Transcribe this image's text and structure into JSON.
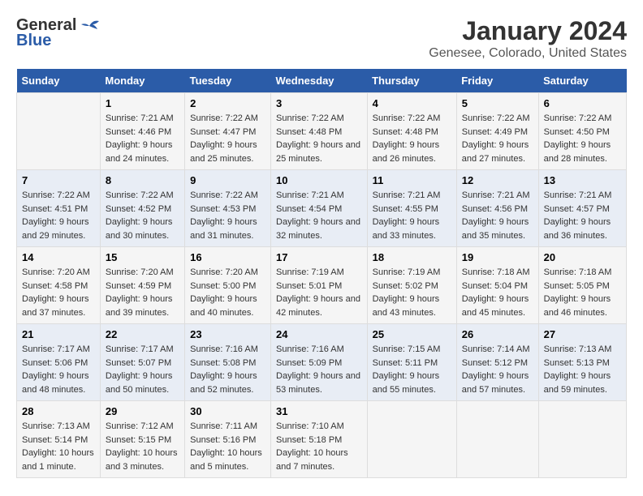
{
  "header": {
    "logo_general": "General",
    "logo_blue": "Blue",
    "title": "January 2024",
    "subtitle": "Genesee, Colorado, United States"
  },
  "days_of_week": [
    "Sunday",
    "Monday",
    "Tuesday",
    "Wednesday",
    "Thursday",
    "Friday",
    "Saturday"
  ],
  "weeks": [
    [
      {
        "day": "",
        "sunrise": "",
        "sunset": "",
        "daylight": ""
      },
      {
        "day": "1",
        "sunrise": "Sunrise: 7:21 AM",
        "sunset": "Sunset: 4:46 PM",
        "daylight": "Daylight: 9 hours and 24 minutes."
      },
      {
        "day": "2",
        "sunrise": "Sunrise: 7:22 AM",
        "sunset": "Sunset: 4:47 PM",
        "daylight": "Daylight: 9 hours and 25 minutes."
      },
      {
        "day": "3",
        "sunrise": "Sunrise: 7:22 AM",
        "sunset": "Sunset: 4:48 PM",
        "daylight": "Daylight: 9 hours and 25 minutes."
      },
      {
        "day": "4",
        "sunrise": "Sunrise: 7:22 AM",
        "sunset": "Sunset: 4:48 PM",
        "daylight": "Daylight: 9 hours and 26 minutes."
      },
      {
        "day": "5",
        "sunrise": "Sunrise: 7:22 AM",
        "sunset": "Sunset: 4:49 PM",
        "daylight": "Daylight: 9 hours and 27 minutes."
      },
      {
        "day": "6",
        "sunrise": "Sunrise: 7:22 AM",
        "sunset": "Sunset: 4:50 PM",
        "daylight": "Daylight: 9 hours and 28 minutes."
      }
    ],
    [
      {
        "day": "7",
        "sunrise": "Sunrise: 7:22 AM",
        "sunset": "Sunset: 4:51 PM",
        "daylight": "Daylight: 9 hours and 29 minutes."
      },
      {
        "day": "8",
        "sunrise": "Sunrise: 7:22 AM",
        "sunset": "Sunset: 4:52 PM",
        "daylight": "Daylight: 9 hours and 30 minutes."
      },
      {
        "day": "9",
        "sunrise": "Sunrise: 7:22 AM",
        "sunset": "Sunset: 4:53 PM",
        "daylight": "Daylight: 9 hours and 31 minutes."
      },
      {
        "day": "10",
        "sunrise": "Sunrise: 7:21 AM",
        "sunset": "Sunset: 4:54 PM",
        "daylight": "Daylight: 9 hours and 32 minutes."
      },
      {
        "day": "11",
        "sunrise": "Sunrise: 7:21 AM",
        "sunset": "Sunset: 4:55 PM",
        "daylight": "Daylight: 9 hours and 33 minutes."
      },
      {
        "day": "12",
        "sunrise": "Sunrise: 7:21 AM",
        "sunset": "Sunset: 4:56 PM",
        "daylight": "Daylight: 9 hours and 35 minutes."
      },
      {
        "day": "13",
        "sunrise": "Sunrise: 7:21 AM",
        "sunset": "Sunset: 4:57 PM",
        "daylight": "Daylight: 9 hours and 36 minutes."
      }
    ],
    [
      {
        "day": "14",
        "sunrise": "Sunrise: 7:20 AM",
        "sunset": "Sunset: 4:58 PM",
        "daylight": "Daylight: 9 hours and 37 minutes."
      },
      {
        "day": "15",
        "sunrise": "Sunrise: 7:20 AM",
        "sunset": "Sunset: 4:59 PM",
        "daylight": "Daylight: 9 hours and 39 minutes."
      },
      {
        "day": "16",
        "sunrise": "Sunrise: 7:20 AM",
        "sunset": "Sunset: 5:00 PM",
        "daylight": "Daylight: 9 hours and 40 minutes."
      },
      {
        "day": "17",
        "sunrise": "Sunrise: 7:19 AM",
        "sunset": "Sunset: 5:01 PM",
        "daylight": "Daylight: 9 hours and 42 minutes."
      },
      {
        "day": "18",
        "sunrise": "Sunrise: 7:19 AM",
        "sunset": "Sunset: 5:02 PM",
        "daylight": "Daylight: 9 hours and 43 minutes."
      },
      {
        "day": "19",
        "sunrise": "Sunrise: 7:18 AM",
        "sunset": "Sunset: 5:04 PM",
        "daylight": "Daylight: 9 hours and 45 minutes."
      },
      {
        "day": "20",
        "sunrise": "Sunrise: 7:18 AM",
        "sunset": "Sunset: 5:05 PM",
        "daylight": "Daylight: 9 hours and 46 minutes."
      }
    ],
    [
      {
        "day": "21",
        "sunrise": "Sunrise: 7:17 AM",
        "sunset": "Sunset: 5:06 PM",
        "daylight": "Daylight: 9 hours and 48 minutes."
      },
      {
        "day": "22",
        "sunrise": "Sunrise: 7:17 AM",
        "sunset": "Sunset: 5:07 PM",
        "daylight": "Daylight: 9 hours and 50 minutes."
      },
      {
        "day": "23",
        "sunrise": "Sunrise: 7:16 AM",
        "sunset": "Sunset: 5:08 PM",
        "daylight": "Daylight: 9 hours and 52 minutes."
      },
      {
        "day": "24",
        "sunrise": "Sunrise: 7:16 AM",
        "sunset": "Sunset: 5:09 PM",
        "daylight": "Daylight: 9 hours and 53 minutes."
      },
      {
        "day": "25",
        "sunrise": "Sunrise: 7:15 AM",
        "sunset": "Sunset: 5:11 PM",
        "daylight": "Daylight: 9 hours and 55 minutes."
      },
      {
        "day": "26",
        "sunrise": "Sunrise: 7:14 AM",
        "sunset": "Sunset: 5:12 PM",
        "daylight": "Daylight: 9 hours and 57 minutes."
      },
      {
        "day": "27",
        "sunrise": "Sunrise: 7:13 AM",
        "sunset": "Sunset: 5:13 PM",
        "daylight": "Daylight: 9 hours and 59 minutes."
      }
    ],
    [
      {
        "day": "28",
        "sunrise": "Sunrise: 7:13 AM",
        "sunset": "Sunset: 5:14 PM",
        "daylight": "Daylight: 10 hours and 1 minute."
      },
      {
        "day": "29",
        "sunrise": "Sunrise: 7:12 AM",
        "sunset": "Sunset: 5:15 PM",
        "daylight": "Daylight: 10 hours and 3 minutes."
      },
      {
        "day": "30",
        "sunrise": "Sunrise: 7:11 AM",
        "sunset": "Sunset: 5:16 PM",
        "daylight": "Daylight: 10 hours and 5 minutes."
      },
      {
        "day": "31",
        "sunrise": "Sunrise: 7:10 AM",
        "sunset": "Sunset: 5:18 PM",
        "daylight": "Daylight: 10 hours and 7 minutes."
      },
      {
        "day": "",
        "sunrise": "",
        "sunset": "",
        "daylight": ""
      },
      {
        "day": "",
        "sunrise": "",
        "sunset": "",
        "daylight": ""
      },
      {
        "day": "",
        "sunrise": "",
        "sunset": "",
        "daylight": ""
      }
    ]
  ]
}
